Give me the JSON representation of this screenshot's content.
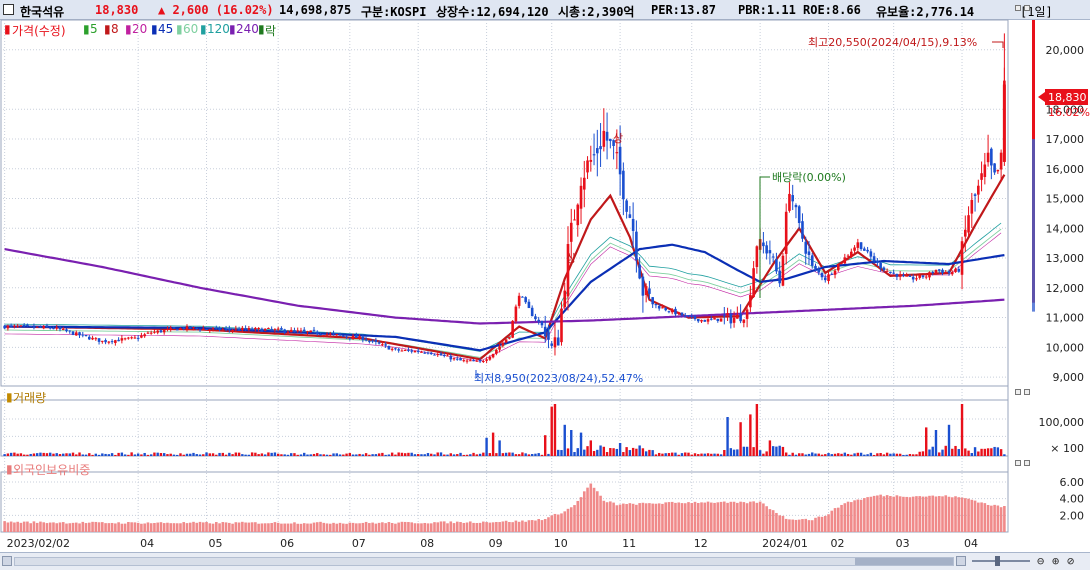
{
  "header": {
    "name": "한국석유",
    "price": "18,830",
    "change": "▲ 2,600 (16.02%)",
    "volume": "14,698,875",
    "market": "구분:KOSPI",
    "listed": "상장수:12,694,120",
    "cap": "시총:2,390억",
    "per": "PER:13.87",
    "pbr": "PBR:1.11",
    "roe": "ROE:8.66",
    "float": "유보율:2,776.14",
    "period": "[1일]"
  },
  "legend": {
    "price": "가격(수정)",
    "ma5": "5",
    "ma8": "8",
    "ma20": "20",
    "ma45": "45",
    "ma60": "60",
    "ma120": "120",
    "ma240": "240",
    "ex": "락"
  },
  "colors": {
    "up": "#e8101a",
    "down": "#1a4fd0",
    "ma5": "#2ca02c",
    "ma8": "#c0181a",
    "ma20": "#c020a0",
    "ma45": "#0b2fb5",
    "ma60": "#7fd0a0",
    "ma120": "#20a0a0",
    "ma240": "#7a20b0",
    "ex": "#1f7a1f"
  },
  "annotations": {
    "high": "최고20,550(2024/04/15),9.13%",
    "low": "최저8,950(2023/08/24),52.47%",
    "dividend": "배당락(0.00%)",
    "sang": "상",
    "current_price": "18,830",
    "current_pct": "16.02%"
  },
  "panels": {
    "volume_title": "거래량",
    "foreign_title": "외국인보유비중"
  },
  "chart_data": [
    {
      "type": "candlestick",
      "title": "가격(수정)",
      "y_ticks": [
        9000,
        10000,
        11000,
        12000,
        13000,
        14000,
        15000,
        16000,
        17000,
        18000,
        20000
      ],
      "y_tick_labels": [
        "9,000",
        "10,000",
        "11,000",
        "12,000",
        "13,000",
        "14,000",
        "15,000",
        "16,000",
        "17,000",
        "18,000",
        "20,000"
      ],
      "ylim": [
        8700,
        21000
      ],
      "x_labels": [
        "2023/02/02",
        "04",
        "05",
        "06",
        "07",
        "08",
        "09",
        "10",
        "11",
        "12",
        "2024/01",
        "02",
        "03",
        "04"
      ],
      "x_label_positions": [
        0,
        41,
        62,
        84,
        106,
        127,
        148,
        168,
        189,
        211,
        232,
        253,
        273,
        294
      ],
      "num_bars": 308,
      "close_path": [
        [
          0,
          10700
        ],
        [
          15,
          10650
        ],
        [
          30,
          10200
        ],
        [
          40,
          10300
        ],
        [
          45,
          10500
        ],
        [
          55,
          10650
        ],
        [
          65,
          10600
        ],
        [
          80,
          10600
        ],
        [
          95,
          10500
        ],
        [
          110,
          10300
        ],
        [
          120,
          9900
        ],
        [
          130,
          9850
        ],
        [
          140,
          9550
        ],
        [
          146,
          9500
        ],
        [
          150,
          9800
        ],
        [
          155,
          10400
        ],
        [
          158,
          11800
        ],
        [
          162,
          11100
        ],
        [
          166,
          10600
        ],
        [
          168,
          9950
        ],
        [
          170,
          10300
        ],
        [
          173,
          13200
        ],
        [
          177,
          15800
        ],
        [
          181,
          16400
        ],
        [
          184,
          17200
        ],
        [
          187,
          16500
        ],
        [
          190,
          15400
        ],
        [
          193,
          14000
        ],
        [
          196,
          11900
        ],
        [
          200,
          11400
        ],
        [
          205,
          11200
        ],
        [
          210,
          11000
        ],
        [
          215,
          10900
        ],
        [
          220,
          10950
        ],
        [
          225,
          11000
        ],
        [
          228,
          11200
        ],
        [
          231,
          13500
        ],
        [
          235,
          13200
        ],
        [
          238,
          12200
        ],
        [
          241,
          15400
        ],
        [
          244,
          14000
        ],
        [
          248,
          12700
        ],
        [
          252,
          12300
        ],
        [
          258,
          13000
        ],
        [
          262,
          13500
        ],
        [
          268,
          12800
        ],
        [
          272,
          12500
        ],
        [
          278,
          12300
        ],
        [
          283,
          12400
        ],
        [
          286,
          12600
        ],
        [
          290,
          12500
        ],
        [
          293,
          12600
        ],
        [
          296,
          14500
        ],
        [
          299,
          15300
        ],
        [
          302,
          16200
        ],
        [
          304,
          15600
        ],
        [
          306,
          16230
        ],
        [
          307,
          18830
        ]
      ],
      "ma_paths": {
        "ma8": [
          [
            0,
            10700
          ],
          [
            60,
            10600
          ],
          [
            110,
            10300
          ],
          [
            146,
            9600
          ],
          [
            158,
            10700
          ],
          [
            166,
            10300
          ],
          [
            172,
            12300
          ],
          [
            180,
            14300
          ],
          [
            186,
            15100
          ],
          [
            192,
            13700
          ],
          [
            198,
            11600
          ],
          [
            210,
            11000
          ],
          [
            226,
            11050
          ],
          [
            236,
            12800
          ],
          [
            244,
            14000
          ],
          [
            252,
            12500
          ],
          [
            262,
            13200
          ],
          [
            272,
            12400
          ],
          [
            290,
            12500
          ],
          [
            298,
            14100
          ],
          [
            307,
            15800
          ]
        ],
        "ma45": [
          [
            0,
            10700
          ],
          [
            60,
            10650
          ],
          [
            120,
            10350
          ],
          [
            146,
            9900
          ],
          [
            166,
            10500
          ],
          [
            180,
            12200
          ],
          [
            195,
            13300
          ],
          [
            205,
            13450
          ],
          [
            215,
            13200
          ],
          [
            225,
            12600
          ],
          [
            232,
            12200
          ],
          [
            240,
            12300
          ],
          [
            252,
            12700
          ],
          [
            270,
            12900
          ],
          [
            290,
            12800
          ],
          [
            307,
            13100
          ]
        ],
        "ma240": [
          [
            0,
            13300
          ],
          [
            30,
            12700
          ],
          [
            60,
            12000
          ],
          [
            90,
            11400
          ],
          [
            120,
            11000
          ],
          [
            146,
            10800
          ],
          [
            180,
            10900
          ],
          [
            200,
            11000
          ],
          [
            220,
            11100
          ],
          [
            240,
            11200
          ],
          [
            260,
            11300
          ],
          [
            280,
            11400
          ],
          [
            307,
            11600
          ]
        ]
      }
    },
    {
      "type": "bar",
      "title": "거래량",
      "y_tick_labels": [
        "100,000",
        "× 100"
      ],
      "spikes": [
        [
          148,
          0.35
        ],
        [
          150,
          0.45
        ],
        [
          152,
          0.3
        ],
        [
          166,
          0.4
        ],
        [
          168,
          0.95
        ],
        [
          169,
          1.0
        ],
        [
          172,
          0.6
        ],
        [
          174,
          0.5
        ],
        [
          177,
          0.45
        ],
        [
          180,
          0.3
        ],
        [
          189,
          0.25
        ],
        [
          222,
          0.75
        ],
        [
          226,
          0.65
        ],
        [
          229,
          0.8
        ],
        [
          231,
          1.0
        ],
        [
          235,
          0.3
        ],
        [
          283,
          0.55
        ],
        [
          286,
          0.5
        ],
        [
          290,
          0.6
        ],
        [
          294,
          1.0
        ]
      ]
    },
    {
      "type": "bar",
      "title": "외국인보유비중",
      "y_tick_labels": [
        "2.00",
        "4.00",
        "6.00"
      ],
      "ylim": [
        0,
        7.2
      ],
      "values_path": [
        [
          0,
          1.2
        ],
        [
          30,
          1.1
        ],
        [
          60,
          1.1
        ],
        [
          90,
          1.1
        ],
        [
          120,
          1.1
        ],
        [
          146,
          1.2
        ],
        [
          160,
          1.3
        ],
        [
          166,
          1.6
        ],
        [
          172,
          2.5
        ],
        [
          175,
          3.2
        ],
        [
          178,
          4.8
        ],
        [
          180,
          5.8
        ],
        [
          182,
          4.8
        ],
        [
          184,
          3.7
        ],
        [
          186,
          3.6
        ],
        [
          188,
          3.3
        ],
        [
          196,
          3.4
        ],
        [
          205,
          3.5
        ],
        [
          215,
          3.6
        ],
        [
          225,
          3.5
        ],
        [
          232,
          3.6
        ],
        [
          240,
          1.6
        ],
        [
          248,
          1.5
        ],
        [
          252,
          2.0
        ],
        [
          258,
          3.5
        ],
        [
          268,
          4.4
        ],
        [
          278,
          4.3
        ],
        [
          290,
          4.3
        ],
        [
          296,
          4.0
        ],
        [
          302,
          3.3
        ],
        [
          307,
          3.0
        ]
      ]
    }
  ]
}
